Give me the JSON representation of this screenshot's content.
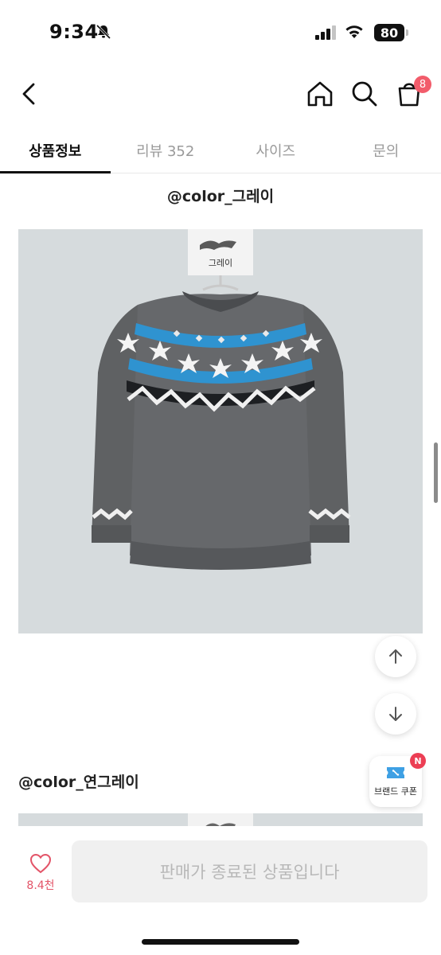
{
  "status_bar": {
    "time": "9:34",
    "battery": "80"
  },
  "header": {
    "cart_count": "8"
  },
  "tabs": [
    {
      "label": "상품정보",
      "active": true
    },
    {
      "label": "리뷰 352",
      "active": false
    },
    {
      "label": "사이즈",
      "active": false
    },
    {
      "label": "문의",
      "active": false
    }
  ],
  "content": {
    "caption_1": "@color_그레이",
    "swatch_tag_label": "그레이",
    "caption_2": "@color_연그레이"
  },
  "floating": {
    "coupon_label": "브랜드 쿠폰",
    "coupon_badge": "N"
  },
  "bottom_bar": {
    "like_count": "8.4천",
    "purchase_label": "판매가 종료된 상품입니다"
  },
  "colors": {
    "accent_red": "#f25c6b",
    "heart_pink": "#e35468",
    "sweater_gray": "#5f6163",
    "pattern_blue": "#2f93d0"
  }
}
